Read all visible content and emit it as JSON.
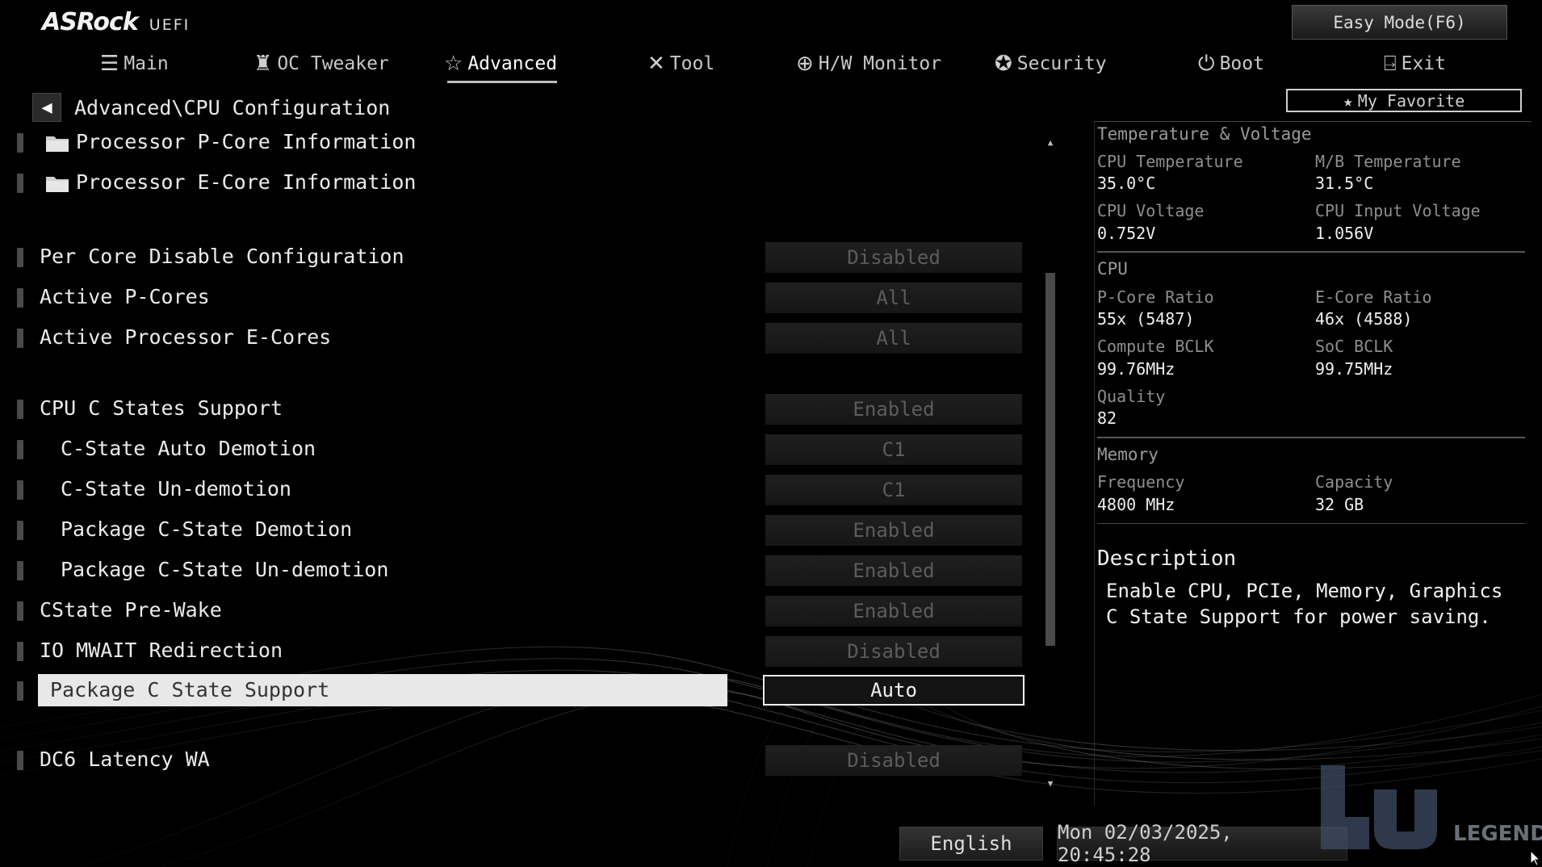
{
  "header": {
    "brand": "ASRock",
    "sub": "UEFI",
    "easy_mode": "Easy Mode(F6)",
    "my_favorite": "My Favorite"
  },
  "tabs": [
    {
      "label": "Main",
      "icon": "list-icon"
    },
    {
      "label": "OC Tweaker",
      "icon": "rocket-icon"
    },
    {
      "label": "Advanced",
      "icon": "star-icon",
      "active": true
    },
    {
      "label": "Tool",
      "icon": "tools-icon"
    },
    {
      "label": "H/W Monitor",
      "icon": "crosshair-icon"
    },
    {
      "label": "Security",
      "icon": "badge-icon"
    },
    {
      "label": "Boot",
      "icon": "power-icon"
    },
    {
      "label": "Exit",
      "icon": "exit-door-icon"
    }
  ],
  "breadcrumb": "Advanced\\CPU Configuration",
  "submenus": [
    {
      "label": "Processor P-Core Information"
    },
    {
      "label": "Processor E-Core Information"
    }
  ],
  "settings": [
    {
      "label": "Per Core Disable Configuration",
      "value": "Disabled"
    },
    {
      "label": "Active P-Cores",
      "value": "All"
    },
    {
      "label": "Active Processor E-Cores",
      "value": "All"
    },
    {
      "label": "CPU C States Support",
      "value": "Enabled"
    },
    {
      "label": "C-State Auto Demotion",
      "value": "C1"
    },
    {
      "label": "C-State Un-demotion",
      "value": "C1"
    },
    {
      "label": "Package C-State Demotion",
      "value": "Enabled"
    },
    {
      "label": "Package C-State Un-demotion",
      "value": "Enabled"
    },
    {
      "label": "CState Pre-Wake",
      "value": "Enabled"
    },
    {
      "label": "IO MWAIT Redirection",
      "value": "Disabled"
    },
    {
      "label": "Package C State Support",
      "value": "Auto",
      "selected": true
    },
    {
      "label": "DC6 Latency WA",
      "value": "Disabled"
    }
  ],
  "scroll": {
    "position": 0.25,
    "visible_fraction": 0.6
  },
  "monitor": {
    "temp_voltage_title": "Temperature & Voltage",
    "cpu_temp_label": "CPU Temperature",
    "cpu_temp": "35.0°C",
    "mb_temp_label": "M/B Temperature",
    "mb_temp": "31.5°C",
    "cpu_voltage_label": "CPU Voltage",
    "cpu_voltage": "0.752V",
    "cpu_input_voltage_label": "CPU Input Voltage",
    "cpu_input_voltage": "1.056V",
    "cpu_title": "CPU",
    "pcore_ratio_label": "P-Core Ratio",
    "pcore_ratio": "55x (5487)",
    "ecore_ratio_label": "E-Core Ratio",
    "ecore_ratio": "46x (4588)",
    "compute_bclk_label": "Compute BCLK",
    "compute_bclk": "99.76MHz",
    "soc_bclk_label": "SoC BCLK",
    "soc_bclk": "99.75MHz",
    "quality_label": "Quality",
    "quality": "82",
    "memory_title": "Memory",
    "frequency_label": "Frequency",
    "frequency": "4800 MHz",
    "capacity_label": "Capacity",
    "capacity": "32 GB"
  },
  "description": {
    "title": "Description",
    "text": "Enable CPU, PCIe, Memory, Graphics C State Support for power saving."
  },
  "footer": {
    "language": "English",
    "datetime": "Mon 02/03/2025, 20:45:28",
    "watermark": "LEGEND"
  },
  "colors": {
    "accent": "#e8e8e8",
    "panel_divider": "#555555",
    "value_disabled": "#5c5c5c"
  }
}
